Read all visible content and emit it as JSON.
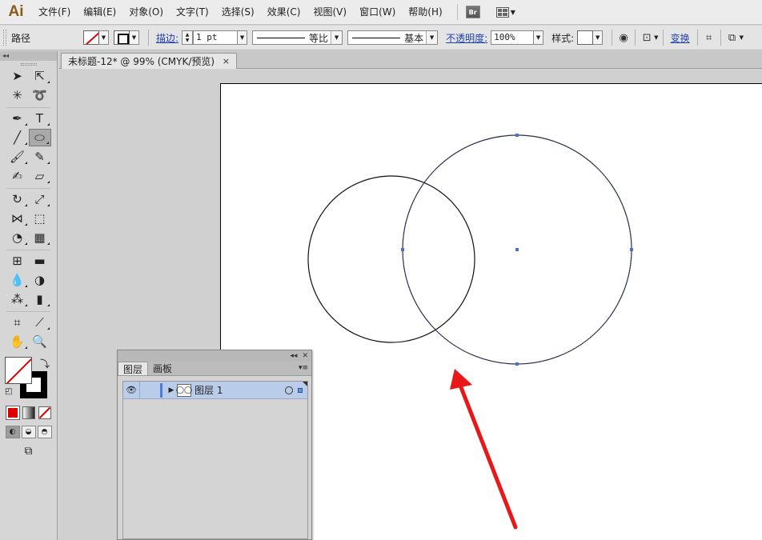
{
  "app": {
    "logo": "Ai"
  },
  "menu": [
    "文件(F)",
    "编辑(E)",
    "对象(O)",
    "文字(T)",
    "选择(S)",
    "效果(C)",
    "视图(V)",
    "窗口(W)",
    "帮助(H)"
  ],
  "menubar_extra": {
    "bridge": "Br"
  },
  "control": {
    "object_type": "路径",
    "stroke_label": "描边:",
    "stroke_weight": "1 pt",
    "profile_label": "等比",
    "brush_label": "基本",
    "opacity_label": "不透明度:",
    "opacity_value": "100%",
    "style_label": "样式:",
    "transform_label": "变换"
  },
  "document": {
    "tab_title": "未标题-12* @ 99% (CMYK/预览)",
    "close": "×"
  },
  "toolbar": {
    "collapse": "◂◂"
  },
  "layers_panel": {
    "collapse": "◂◂",
    "close": "✕",
    "tabs": [
      "图层",
      "画板"
    ],
    "layer_name": "图层 1",
    "menu": "▾≡"
  },
  "colors": {
    "accent_red": "#e00000",
    "selection_blue": "#4a72c8",
    "layer_highlight": "#b9cdea"
  },
  "artwork": {
    "shapes": [
      "circle-outline",
      "selected-circle"
    ],
    "annotation": "red-arrow"
  }
}
